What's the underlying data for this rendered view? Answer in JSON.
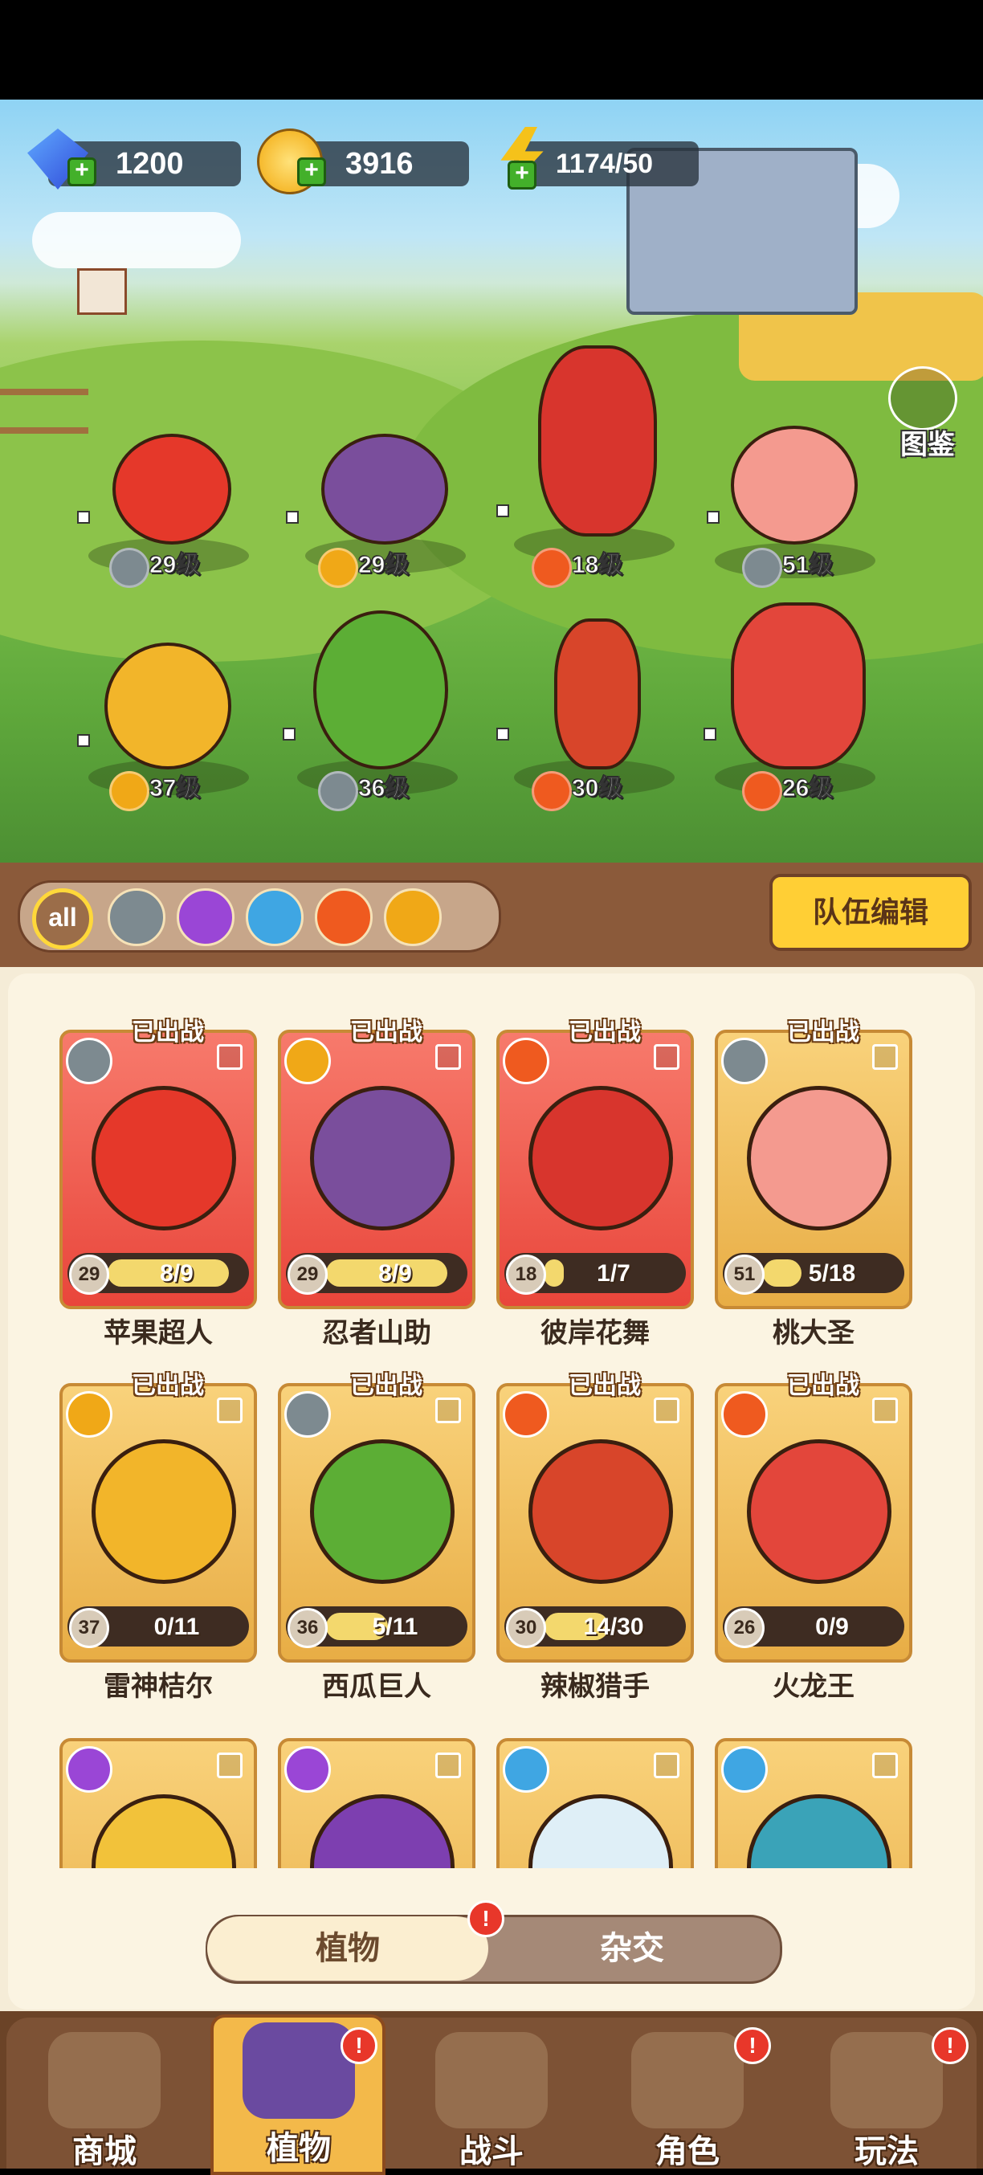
{
  "resources": {
    "gems": "1200",
    "coins": "3916",
    "energy": "1174/50"
  },
  "codex_label": "图鉴",
  "field_lineup": [
    {
      "element": "sword",
      "level": "29级"
    },
    {
      "element": "bolt",
      "level": "29级"
    },
    {
      "element": "fire",
      "level": "18级"
    },
    {
      "element": "sword",
      "level": "51级"
    },
    {
      "element": "bolt",
      "level": "37级"
    },
    {
      "element": "sword",
      "level": "36级"
    },
    {
      "element": "fire",
      "level": "30级"
    },
    {
      "element": "fire",
      "level": "26级"
    }
  ],
  "filters": {
    "all_label": "all",
    "elements": [
      "sword",
      "poison",
      "water",
      "fire",
      "bolt"
    ]
  },
  "team_edit_label": "队伍编辑",
  "deployed_label": "已出战",
  "cards": [
    {
      "name": "苹果超人",
      "level": "29",
      "progress": "8/9",
      "fill": 0.89,
      "element": "sword",
      "style": "red",
      "art": "#e5382a"
    },
    {
      "name": "忍者山助",
      "level": "29",
      "progress": "8/9",
      "fill": 0.89,
      "element": "bolt",
      "style": "red",
      "art": "#7a4e9c"
    },
    {
      "name": "彼岸花舞",
      "level": "18",
      "progress": "1/7",
      "fill": 0.14,
      "element": "fire",
      "style": "red",
      "art": "#d8352d"
    },
    {
      "name": "桃大圣",
      "level": "51",
      "progress": "5/18",
      "fill": 0.28,
      "element": "sword",
      "style": "gold",
      "art": "#f49a8f"
    },
    {
      "name": "雷神桔尔",
      "level": "37",
      "progress": "0/11",
      "fill": 0.0,
      "element": "bolt",
      "style": "gold",
      "art": "#f2b52a"
    },
    {
      "name": "西瓜巨人",
      "level": "36",
      "progress": "5/11",
      "fill": 0.45,
      "element": "sword",
      "style": "gold",
      "art": "#5cae35"
    },
    {
      "name": "辣椒猎手",
      "level": "30",
      "progress": "14/30",
      "fill": 0.47,
      "element": "fire",
      "style": "gold",
      "art": "#d8452a"
    },
    {
      "name": "火龙王",
      "level": "26",
      "progress": "0/9",
      "fill": 0.0,
      "element": "fire",
      "style": "gold",
      "art": "#e3463b"
    }
  ],
  "cards_partial": [
    {
      "element": "poison",
      "art": "#f2c23a"
    },
    {
      "element": "poison",
      "art": "#7d3fb0"
    },
    {
      "element": "water",
      "art": "#dfeff7"
    },
    {
      "element": "water",
      "art": "#3aa3b8"
    }
  ],
  "toggle": {
    "plant": "植物",
    "cross": "杂交",
    "badge": "!"
  },
  "nav": {
    "shop": "商城",
    "plants": "植物",
    "battle": "战斗",
    "character": "角色",
    "modes": "玩法"
  }
}
